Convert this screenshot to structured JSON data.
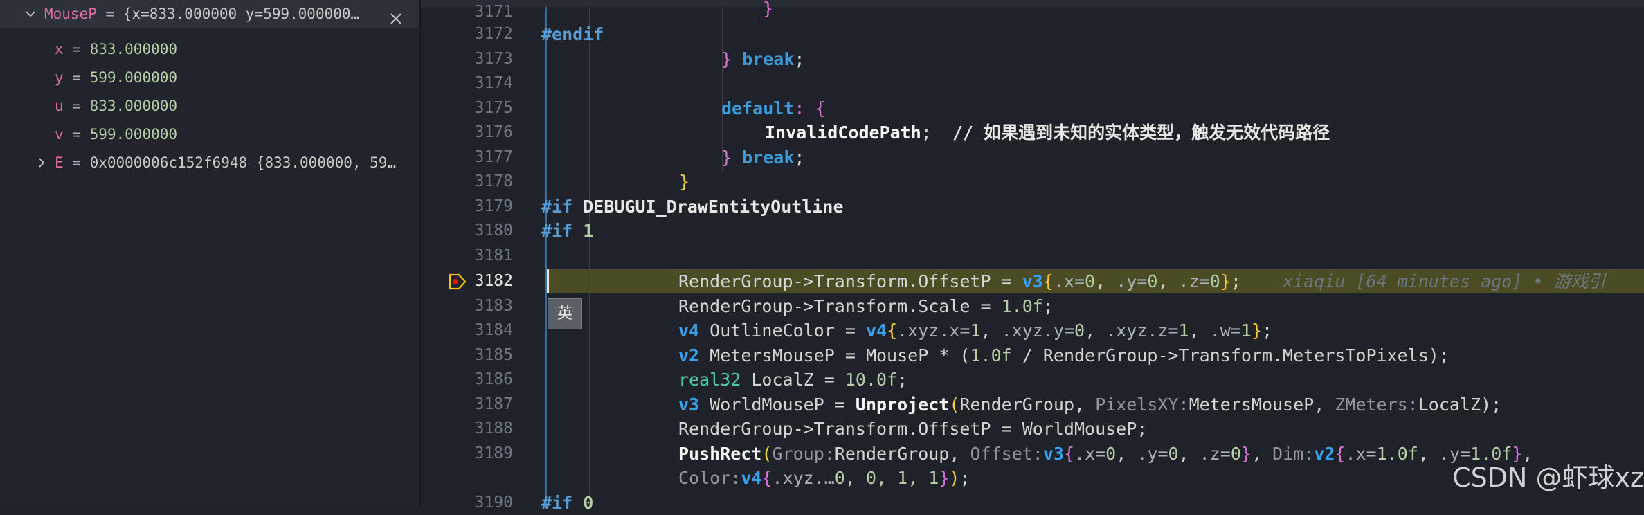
{
  "watch": {
    "root": {
      "name": "MouseP",
      "eq": " = ",
      "value": "{x=833.000000 y=599.000000…"
    },
    "fields": [
      {
        "name": "x",
        "eq": " = ",
        "value": "833.000000"
      },
      {
        "name": "y",
        "eq": " = ",
        "value": "599.000000"
      },
      {
        "name": "u",
        "eq": " = ",
        "value": "833.000000"
      },
      {
        "name": "v",
        "eq": " = ",
        "value": "599.000000"
      }
    ],
    "child": {
      "name": "E",
      "eq": " = ",
      "value": "0x0000006c152f6948 {833.000000, 59…"
    }
  },
  "editor": {
    "line_numbers": [
      "3171",
      "3172",
      "3173",
      "3174",
      "3175",
      "3176",
      "3177",
      "3178",
      "3179",
      "3180",
      "3181",
      "3182",
      "3183",
      "3184",
      "3185",
      "3186",
      "3187",
      "3188",
      "3189",
      "",
      "3190"
    ],
    "tokens": {
      "endif": "#endif",
      "brace_close": "}",
      "break": "break",
      "semi": ";",
      "default": "default",
      "colon_brace": ": {",
      "invalid": "InvalidCodePath",
      "comment": "// 如果遇到未知的实体类型，触发无效代码路径",
      "if": "#if",
      "debug_macro": "DEBUGUI_DrawEntityOutline",
      "one": "1",
      "zero": "0",
      "render_group": "RenderGroup",
      "arrow_transform_offset": "->Transform.OffsetP",
      "arrow_transform_scale": "->Transform.Scale",
      "arrow_transform_mtp": "->Transform.MetersToPixels",
      "assign": " = ",
      "v2": "v2",
      "v3": "v3",
      "v4": "v4",
      "real32": "real32",
      "mx": ".x=",
      "my": ".y=",
      "mz": ".z=",
      "mxyzx": ".xyz.x=",
      "mxyzy": ".xyz.y=",
      "mxyzz": ".xyz.z=",
      "mw": ".w=",
      "mxyzdots": ".xyz.…",
      "comma": ", ",
      "close_semi": "};",
      "f1": "1.0f",
      "f10": "10.0f",
      "outline_color": "OutlineColor",
      "meters_mouse": "MetersMouseP",
      "mouse_p": "MouseP",
      "local_z": "LocalZ",
      "world_mouse": "WorldMouseP",
      "unproject": "Unproject",
      "pixels_xy": "PixelsXY:",
      "zmeters": "ZMeters:",
      "push_rect": "PushRect",
      "group_hint": "Group:",
      "offset_hint": "Offset:",
      "dim_hint": "Dim:",
      "color_hint": "Color:",
      "mul_open": " * (",
      "div": " / ",
      "close_paren_semi": ");",
      "paren_open": "(",
      "blame": "xiaqiu [64 minutes ago] • 游戏引",
      "rest_color": "0, 0, 1, 1",
      "close_all": "});"
    },
    "ime_label": "英",
    "watermark": "CSDN @虾球xz"
  }
}
